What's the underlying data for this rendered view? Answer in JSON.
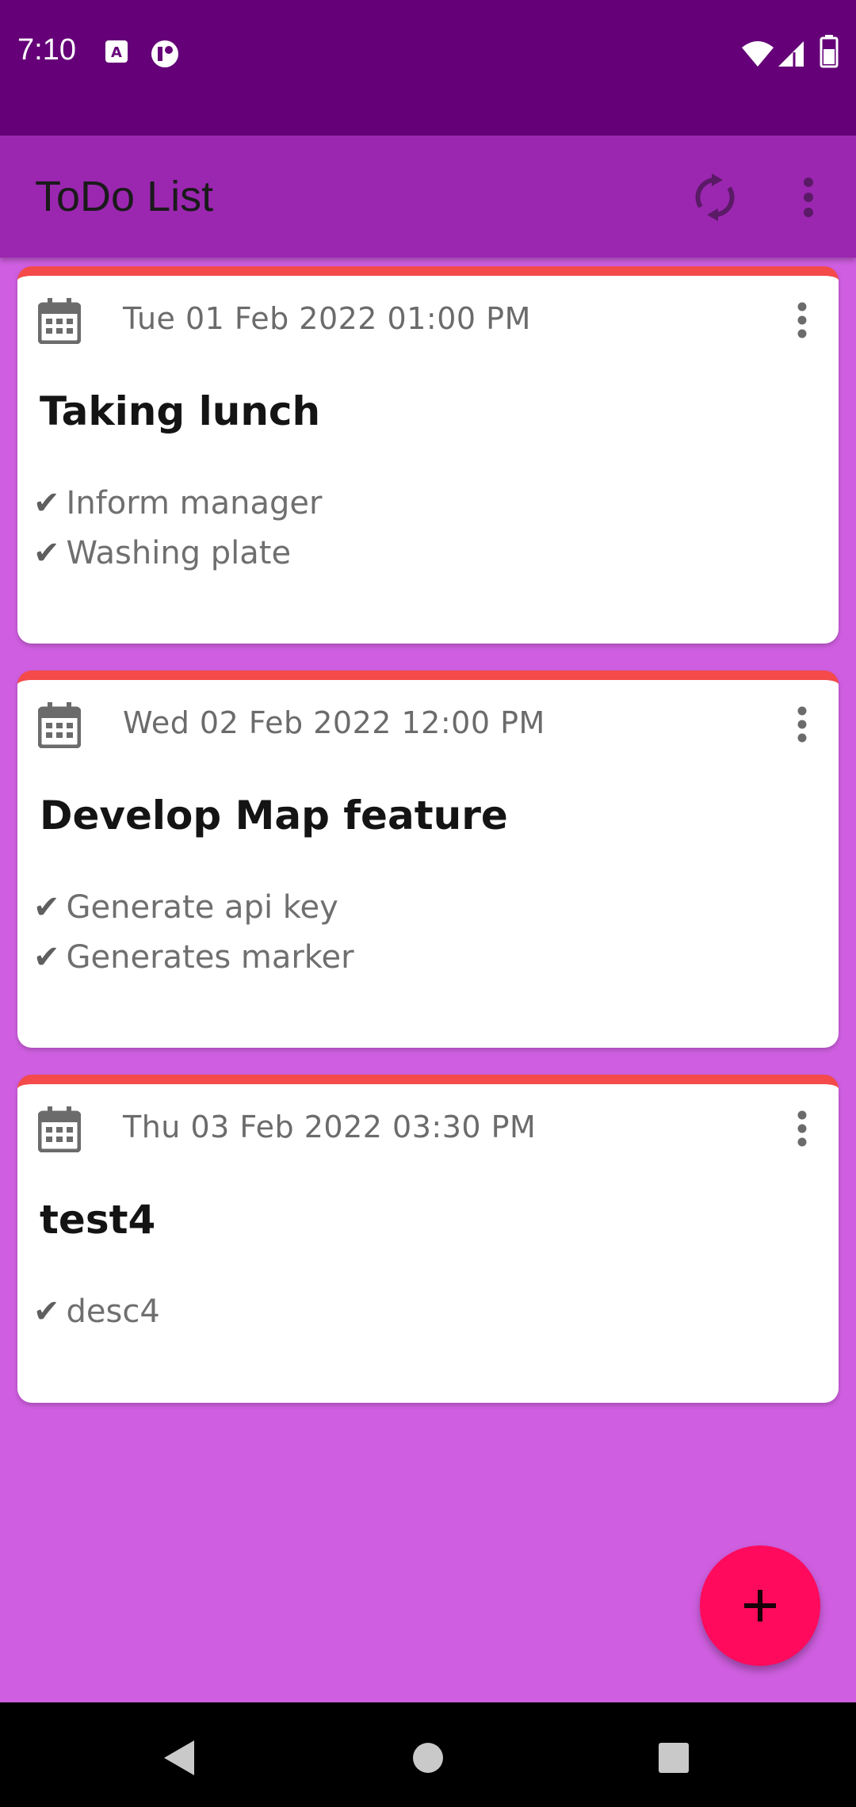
{
  "status_bar": {
    "time": "7:10",
    "icons": [
      "a-box-icon",
      "app-badge-icon",
      "wifi-icon",
      "cellular-signal-icon",
      "battery-icon"
    ]
  },
  "app_bar": {
    "title": "ToDo List",
    "actions": [
      "sync-icon",
      "more-vert-icon"
    ]
  },
  "todos": [
    {
      "date": "Tue 01 Feb 2022 01:00 PM",
      "title": "Taking lunch",
      "items": [
        "Inform manager",
        "Washing plate"
      ]
    },
    {
      "date": "Wed 02 Feb 2022 12:00 PM",
      "title": "Develop Map feature",
      "items": [
        "Generate api key",
        "Generates marker"
      ]
    },
    {
      "date": "Thu 03 Feb 2022 03:30 PM",
      "title": "test4",
      "items": [
        "desc4"
      ]
    }
  ],
  "check_glyph": "✔",
  "fab": {
    "icon": "plus-icon"
  },
  "nav_bar": {
    "buttons": [
      "back-icon",
      "home-icon",
      "recents-icon"
    ]
  },
  "colors": {
    "status_bar": "#650078",
    "app_bar": "#9b27b0",
    "background": "#cf5fe0",
    "card_accent": "#f44a4a",
    "fab": "#ff0a5c"
  }
}
